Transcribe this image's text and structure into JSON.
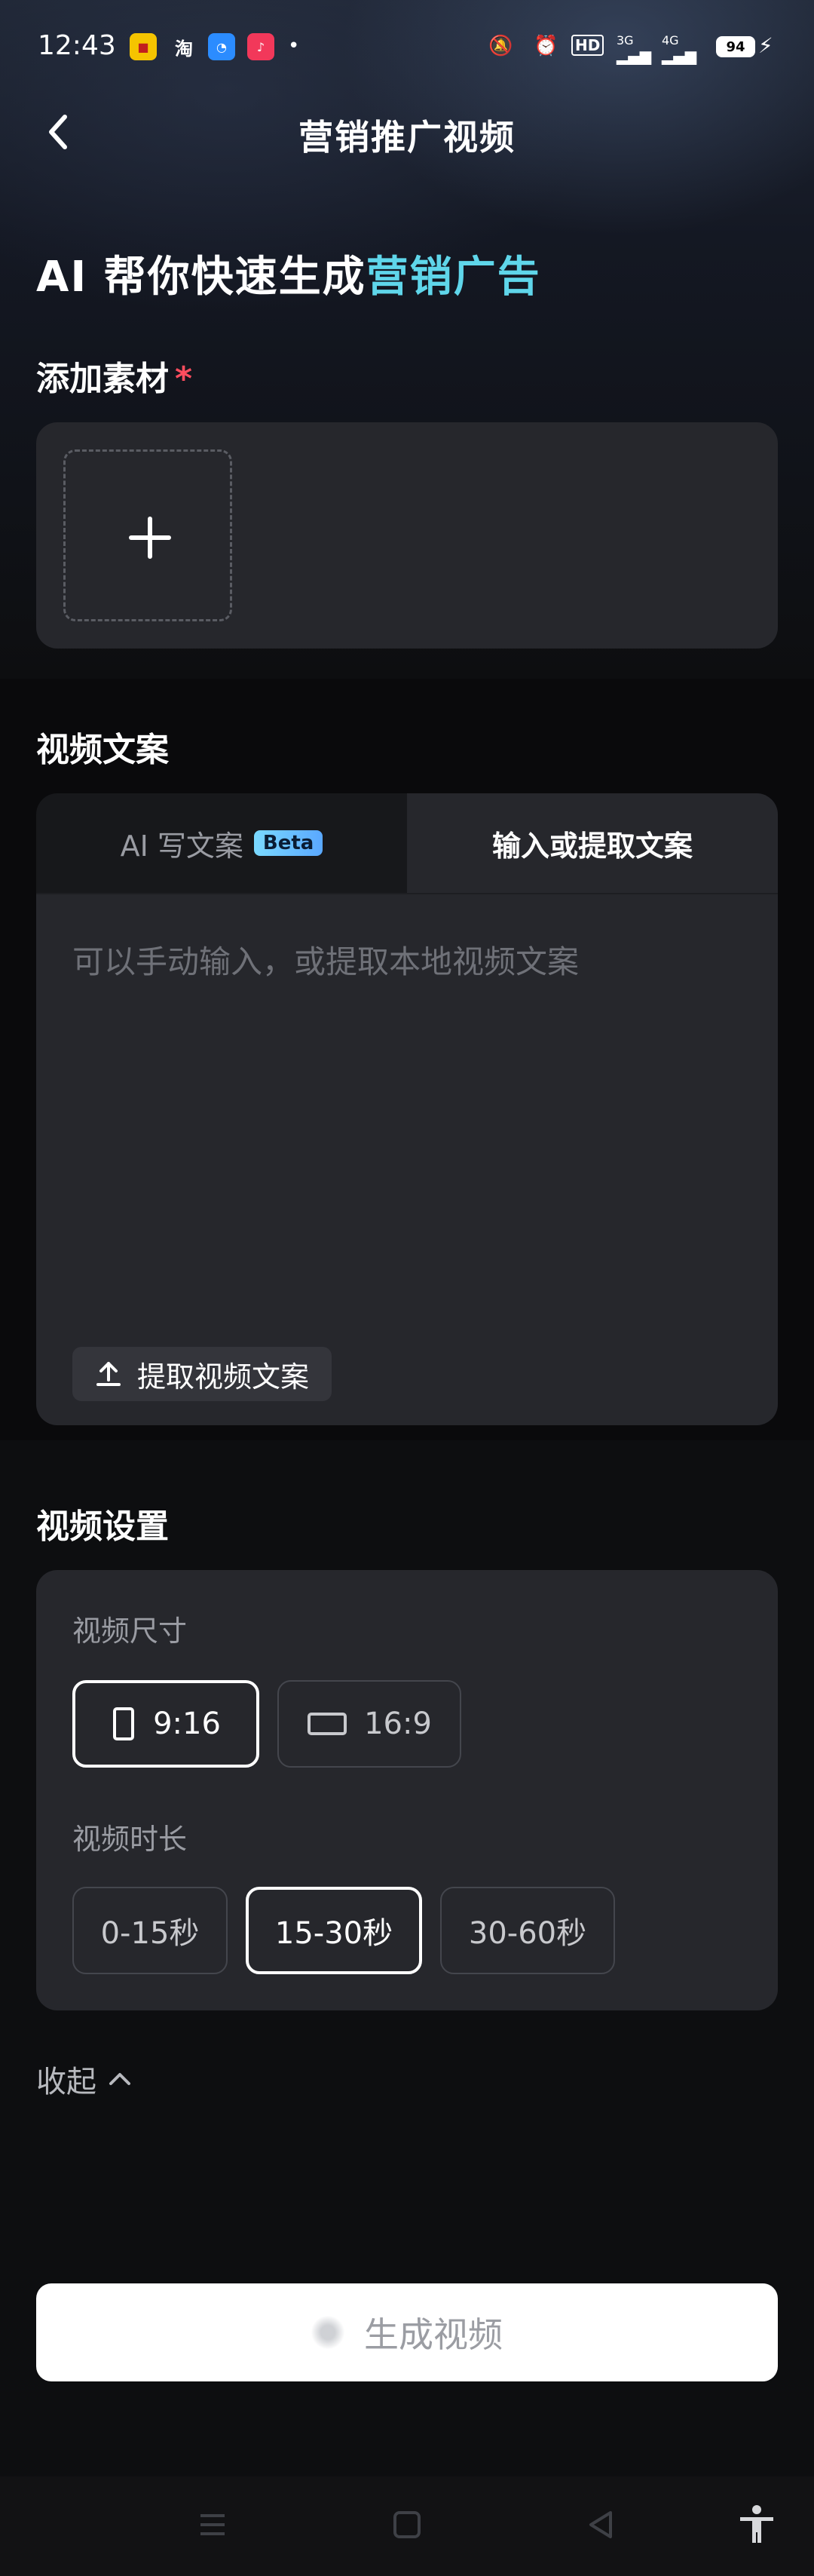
{
  "status_bar": {
    "time": "12:43",
    "network_3g": "3G",
    "network_4g": "4G",
    "hd_label": "HD",
    "battery": "94"
  },
  "nav": {
    "title": "营销推广视频"
  },
  "headline": {
    "prefix": "AI 帮你快速生成",
    "accent": "营销广告"
  },
  "add_material": {
    "label": "添加素材",
    "required_mark": "*"
  },
  "video_copy": {
    "label": "视频文案",
    "tabs": [
      {
        "label": "AI 写文案",
        "badge": "Beta",
        "active": false
      },
      {
        "label": "输入或提取文案",
        "active": true
      }
    ],
    "placeholder": "可以手动输入，或提取本地视频文案",
    "extract_button": "提取视频文案"
  },
  "video_settings": {
    "label": "视频设置",
    "size_label": "视频尺寸",
    "sizes": [
      {
        "label": "9:16",
        "selected": true
      },
      {
        "label": "16:9",
        "selected": false
      }
    ],
    "duration_label": "视频时长",
    "durations": [
      {
        "label": "0-15秒",
        "selected": false
      },
      {
        "label": "15-30秒",
        "selected": true
      },
      {
        "label": "30-60秒",
        "selected": false
      }
    ]
  },
  "collapse_label": "收起",
  "generate_button": "生成视频",
  "colors": {
    "accent": "#5fd6ea",
    "required": "#ff4d5e",
    "card": "#26272c",
    "background": "#0d0e10"
  }
}
